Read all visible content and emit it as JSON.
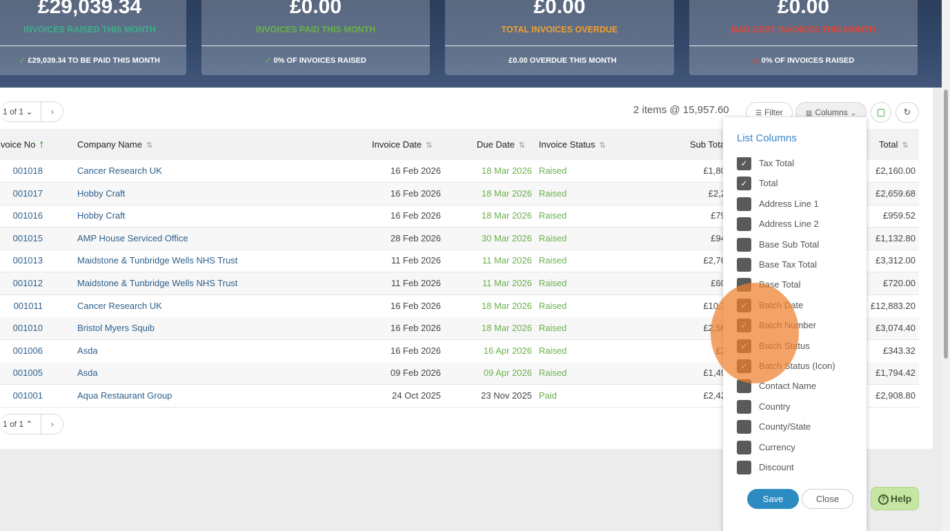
{
  "summary_cards": [
    {
      "amount": "£29,039.34",
      "label": "INVOICES RAISED THIS MONTH",
      "label_color": "#3fae8a",
      "foot_icon": "check-icon",
      "foot_icon_glyph": "✓",
      "foot_icon_color": "#6ab04c",
      "foot": "£29,039.34 TO BE PAID THIS MONTH"
    },
    {
      "amount": "£0.00",
      "label": "INVOICES PAID THIS MONTH",
      "label_color": "#6ab04c",
      "foot_icon": "check-icon",
      "foot_icon_glyph": "✓",
      "foot_icon_color": "#6ab04c",
      "foot": "0% OF INVOICES RAISED"
    },
    {
      "amount": "£0.00",
      "label": "TOTAL INVOICES OVERDUE",
      "label_color": "#f0a030",
      "foot_icon": "arrow-up-icon",
      "foot_icon_glyph": "↑",
      "foot_icon_color": "#6ab04c",
      "foot": "£0.00 OVERDUE THIS MONTH"
    },
    {
      "amount": "£0.00",
      "label": "BAD DEBT INVOICES THIS MONTH",
      "label_color": "#e0453a",
      "foot_icon": "warning-icon",
      "foot_icon_glyph": "⚠",
      "foot_icon_color": "#e0453a",
      "foot": "0% OF INVOICES RAISED"
    }
  ],
  "pager": {
    "top_label": "1 of 1 ⌄",
    "bottom_label": "1 of 1 ⌃",
    "next": "›"
  },
  "toolbar": {
    "items_text": "2 items @ 15,957.60",
    "filter_label": "Filter",
    "columns_label": "Columns",
    "export_icon": "excel-icon",
    "refresh_icon": "refresh-icon"
  },
  "table": {
    "headers": {
      "invoice_no": "Invoice No",
      "company": "Company Name",
      "invoice_date": "Invoice Date",
      "due_date": "Due Date",
      "status": "Invoice Status",
      "sub_total": "Sub Total",
      "total": "Total"
    },
    "rows": [
      {
        "no": "001018",
        "company": "Cancer Research UK",
        "invoice_date": "16 Feb 2026",
        "due_date": "18 Mar 2026",
        "status": "Raised",
        "sub_total": "£1,80",
        "total": "£2,160.00"
      },
      {
        "no": "001017",
        "company": "Hobby Craft",
        "invoice_date": "16 Feb 2026",
        "due_date": "18 Mar 2026",
        "status": "Raised",
        "sub_total": "£2,2",
        "total": "£2,659.68"
      },
      {
        "no": "001016",
        "company": "Hobby Craft",
        "invoice_date": "16 Feb 2026",
        "due_date": "18 Mar 2026",
        "status": "Raised",
        "sub_total": "£79",
        "total": "£959.52"
      },
      {
        "no": "001015",
        "company": "AMP House Serviced Office",
        "invoice_date": "28 Feb 2026",
        "due_date": "30 Mar 2026",
        "status": "Raised",
        "sub_total": "£94",
        "total": "£1,132.80"
      },
      {
        "no": "001013",
        "company": "Maidstone & Tunbridge Wells NHS Trust",
        "invoice_date": "11 Feb 2026",
        "due_date": "11 Mar 2026",
        "status": "Raised",
        "sub_total": "£2,76",
        "total": "£3,312.00"
      },
      {
        "no": "001012",
        "company": "Maidstone & Tunbridge Wells NHS Trust",
        "invoice_date": "11 Feb 2026",
        "due_date": "11 Mar 2026",
        "status": "Raised",
        "sub_total": "£60",
        "total": "£720.00"
      },
      {
        "no": "001011",
        "company": "Cancer Research UK",
        "invoice_date": "16 Feb 2026",
        "due_date": "18 Mar 2026",
        "status": "Raised",
        "sub_total": "£10,7",
        "total": "£12,883.20"
      },
      {
        "no": "001010",
        "company": "Bristol Myers Squib",
        "invoice_date": "16 Feb 2026",
        "due_date": "18 Mar 2026",
        "status": "Raised",
        "sub_total": "£2,56",
        "total": "£3,074.40"
      },
      {
        "no": "001006",
        "company": "Asda",
        "invoice_date": "16 Feb 2026",
        "due_date": "16 Apr 2026",
        "status": "Raised",
        "sub_total": "£2",
        "total": "£343.32"
      },
      {
        "no": "001005",
        "company": "Asda",
        "invoice_date": "09 Feb 2026",
        "due_date": "09 Apr 2026",
        "status": "Raised",
        "sub_total": "£1,49",
        "total": "£1,794.42"
      },
      {
        "no": "001001",
        "company": "Aqua Restaurant Group",
        "invoice_date": "24 Oct 2025",
        "due_date": "23 Nov 2025",
        "status": "Paid",
        "sub_total": "£2,42",
        "total": "£2,908.80"
      }
    ]
  },
  "column_panel": {
    "title": "List Columns",
    "items": [
      {
        "label": "Tax Total",
        "checked": true
      },
      {
        "label": "Total",
        "checked": true
      },
      {
        "label": "Address Line 1",
        "checked": false
      },
      {
        "label": "Address Line 2",
        "checked": false
      },
      {
        "label": "Base Sub Total",
        "checked": false
      },
      {
        "label": "Base Tax Total",
        "checked": false
      },
      {
        "label": "Base Total",
        "checked": false
      },
      {
        "label": "Batch Date",
        "checked": true
      },
      {
        "label": "Batch Number",
        "checked": true
      },
      {
        "label": "Batch Status",
        "checked": true
      },
      {
        "label": "Batch Status (Icon)",
        "checked": true
      },
      {
        "label": "Contact Name",
        "checked": false
      },
      {
        "label": "Country",
        "checked": false
      },
      {
        "label": "County/State",
        "checked": false
      },
      {
        "label": "Currency",
        "checked": false
      },
      {
        "label": "Discount",
        "checked": false
      }
    ],
    "save_label": "Save",
    "close_label": "Close"
  },
  "help": {
    "label": "Help",
    "icon": "question-circle-icon"
  }
}
